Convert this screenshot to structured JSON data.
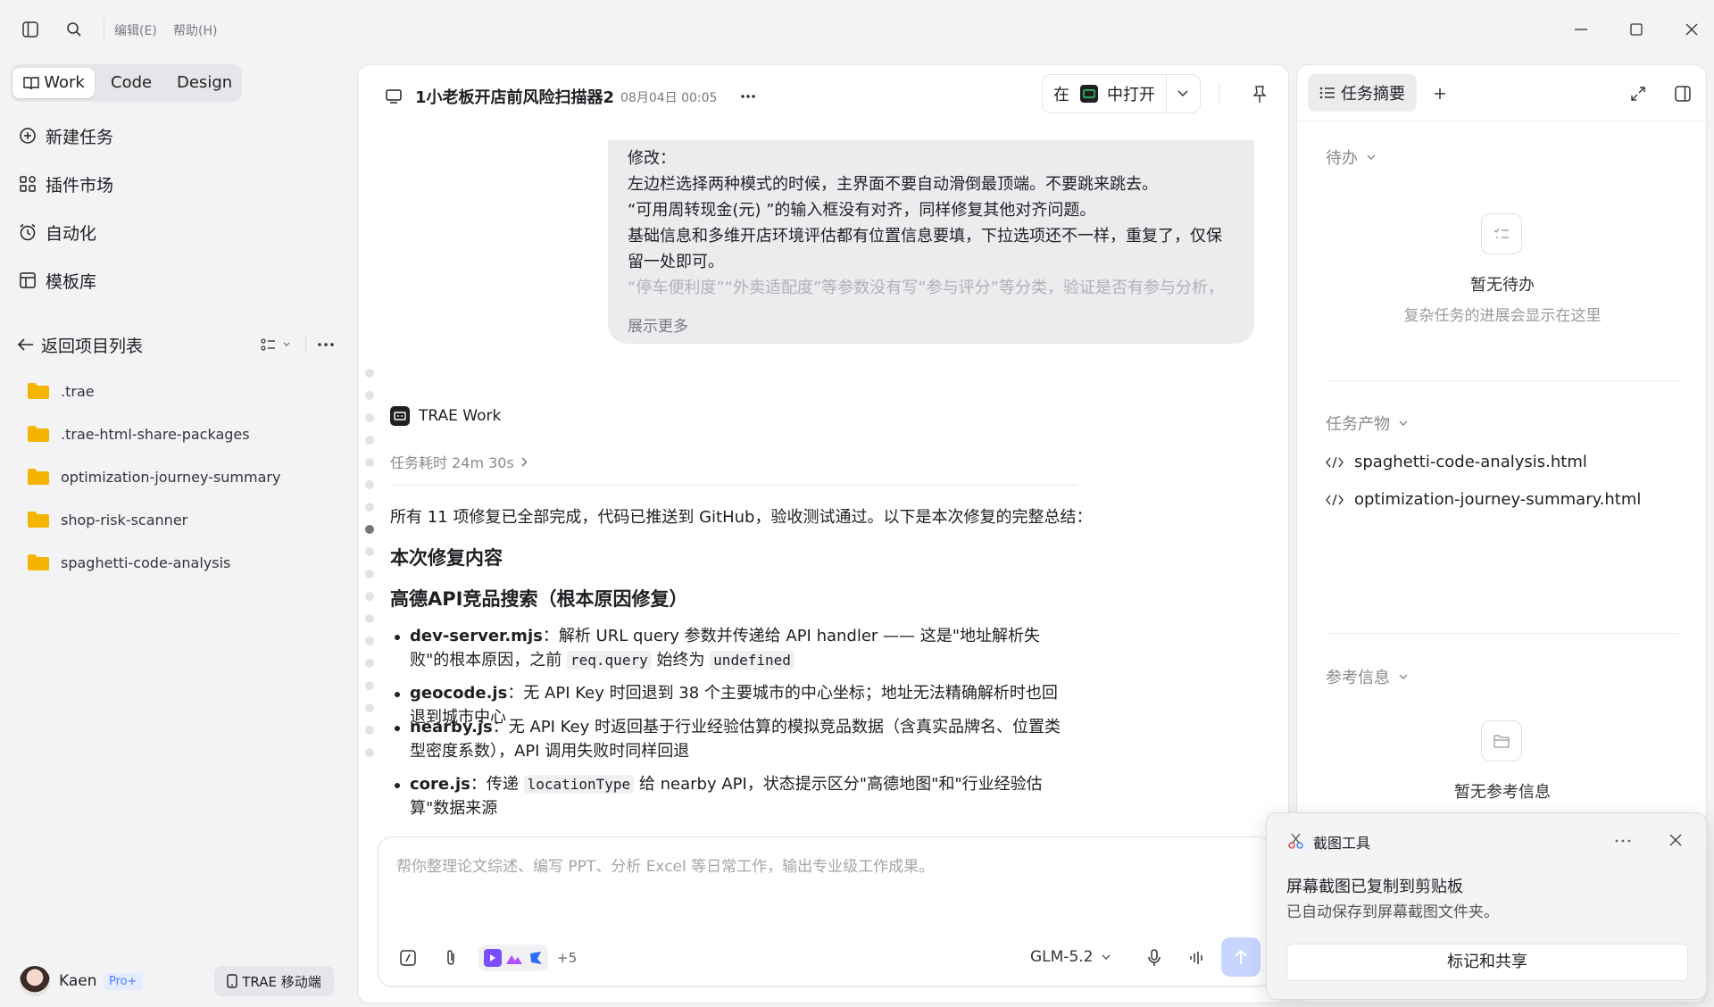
{
  "titlebar": {
    "menu_edit": "编辑(E)",
    "menu_help": "帮助(H)"
  },
  "sidebar": {
    "modes": [
      "Work",
      "Code",
      "Design"
    ],
    "active_mode": "Work",
    "nav": [
      {
        "label": "新建任务",
        "icon": "new-task-icon"
      },
      {
        "label": "插件市场",
        "icon": "plugin-icon"
      },
      {
        "label": "自动化",
        "icon": "clock-icon"
      },
      {
        "label": "模板库",
        "icon": "template-icon"
      }
    ],
    "back_label": "返回项目列表",
    "folders": [
      ".trae",
      ".trae-html-share-packages",
      "optimization-journey-summary",
      "shop-risk-scanner",
      "spaghetti-code-analysis"
    ],
    "user": {
      "name": "Kaen",
      "badge": "Pro+",
      "mobile_label": "TRAE 移动端"
    }
  },
  "main": {
    "task_title": "1小老板开店前风险扫描器2",
    "task_time": "08月04日 00:05",
    "open_in_prefix": "在",
    "open_in_suffix": "中打开",
    "message": {
      "line1": "修改：",
      "line2": "左边栏选择两种模式的时候，主界面不要自动滑倒最顶端。不要跳来跳去。",
      "line3": "“可用周转现金(元) ”的输入框没有对齐，同样修复其他对齐问题。",
      "line4": "基础信息和多维开店环境评估都有位置信息要填，下拉选项还不一样，重复了，仅保留一处即可。",
      "line5": "“停车便利度”“外卖适配度”等参数没有写“参与评分”等分类，验证是否有参与分析，",
      "show_more": "展示更多"
    },
    "agent_name": "TRAE Work",
    "duration": "任务耗时 24m 30s",
    "summary": "所有 11 项修复已全部完成，代码已推送到 GitHub，验收测试通过。以下是本次修复的完整总结：",
    "heading1": "本次修复内容",
    "heading2": "高德API竞品搜索（根本原因修复）",
    "bullets": [
      {
        "name": "dev-server.mjs",
        "text_a": "：解析 URL query 参数并传递给 API handler —— 这是\"地址解析失败\"的根本原因，之前 ",
        "code1": "req.query",
        "text_b": " 始终为 ",
        "code2": "undefined"
      },
      {
        "name": "geocode.js",
        "text": "：无 API Key 时回退到 38 个主要城市的中心坐标；地址无法精确解析时也回退到城市中心"
      },
      {
        "name": "nearby.js",
        "text": "：无 API Key 时返回基于行业经验估算的模拟竞品数据（含真实品牌名、位置类型密度系数），API 调用失败时同样回退"
      },
      {
        "name": "core.js",
        "text_a": "：传递 ",
        "code1": "locationType",
        "text_b": " 给 nearby API，状态提示区分\"高德地图\"和\"行业经验估算\"数据来源"
      }
    ],
    "input_placeholder": "帮你整理论文综述、编写 PPT、分析 Excel 等日常工作，输出专业级工作成果。",
    "plugins_more": "+5",
    "model": "GLM-5.2"
  },
  "right": {
    "tab_label": "任务摘要",
    "todo_title": "待办",
    "todo_empty": "暂无待办",
    "todo_hint": "复杂任务的进展会显示在这里",
    "artifacts_title": "任务产物",
    "artifacts": [
      "spaghetti-code-analysis.html",
      "optimization-journey-summary.html"
    ],
    "refs_title": "参考信息",
    "refs_empty": "暂无参考信息"
  },
  "toast": {
    "app": "截图工具",
    "title": "屏幕截图已复制到剪贴板",
    "body": "已自动保存到屏幕截图文件夹。",
    "action": "标记和共享"
  },
  "colors": {
    "accent": "#2f6bff",
    "folder": "#f4b400",
    "pro_badge": "#4f7cff",
    "send_disabled": "#c8d6ff"
  }
}
